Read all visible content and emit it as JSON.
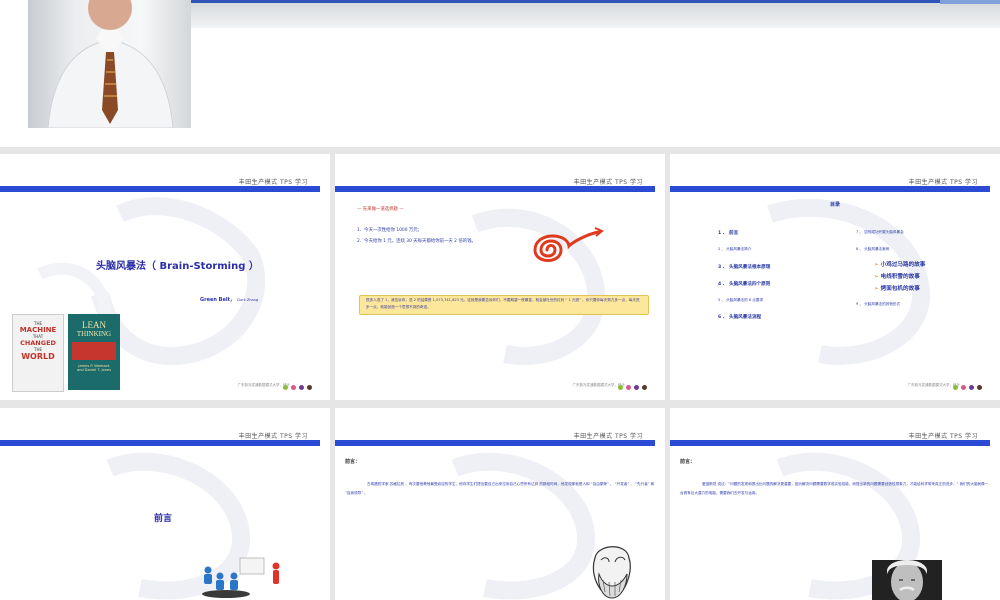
{
  "common": {
    "header": "丰田生产模式 TPS 学习",
    "footer": "广东新冯发通数据模式大学，统计",
    "dot_colors": [
      "#8bbd3c",
      "#d95a8a",
      "#6f3a96",
      "#5b3a2a"
    ]
  },
  "slide1": {
    "title": "头脑风暴法（ Brain-Storming ）",
    "author": "Green Belt，",
    "author_small": "Clark Zhang",
    "book1": {
      "l1": "THE",
      "l2": "MACHINE",
      "l3": "THAT",
      "l4": "CHANGED",
      "l5": "THE",
      "l6": "WORLD"
    },
    "book2": {
      "l1": "LEAN",
      "l2": "THINKING",
      "a1": "James P. Womack",
      "a2": "and Daniel T. Jones"
    }
  },
  "slide2": {
    "intro": "— 先来做一道选择题 —",
    "opt1": "1．今天一次性给你 1000 万元；",
    "opt2": "2．今天给你 1 元，连续 30 天每天都给你前一天 2 倍的钱。",
    "answer": "很多人选了 1，我告诉你，选 2 的结果是 1,073,741,823 元。这就是我要告诉你们，不要期望一夜暴富，就会被吐世的红利 “ 1 元钱” ，你只要你每天努力多一点，每天进步一点，就能创造一个意想不到的奇迹。"
  },
  "slide3": {
    "title": "目录",
    "left": [
      "1 、 前言",
      "2 、 头脑风暴法简介",
      "3 、 头脑风暴法根本原理",
      "4 、 头脑风暴法四个原则",
      "5 、 头脑风暴法的 8 点要求",
      "6 、 头脑风暴法流程"
    ],
    "right7": "7 、 如何成功开展头脑风暴会",
    "right8": "8 、 头脑风暴法案例",
    "sub": [
      "小鸡过马路的故事",
      "电线积雪的故事",
      "烤面包机的故事"
    ],
    "right9": "9 、 头脑风暴法的其他形式"
  },
  "slide4": {
    "title": "前言"
  },
  "slide5": {
    "label": "前言：",
    "text": "古希腊哲学家 苏格拉底 ，有次要他教他最受欢迎的学生，他向学生们提出要自己出来拉到自己心思所有达到 的那段时间，他发现那就是人和 “自由繁荣” 、 “开发者” 、 “先行者” 和 “自我领导” 。"
  },
  "slide6": {
    "label": "前言：",
    "text": "爱因斯坦 说过：“问题的发现和提出比问题的解决更重要，因为解决问题需要数学或实验技能，而提出新的问题需要创造性想象力，才能给科学带来真正的进步。” 我们的大脑就像一台具有巨大潜力的电脑，需要我们去开发与运用。"
  }
}
